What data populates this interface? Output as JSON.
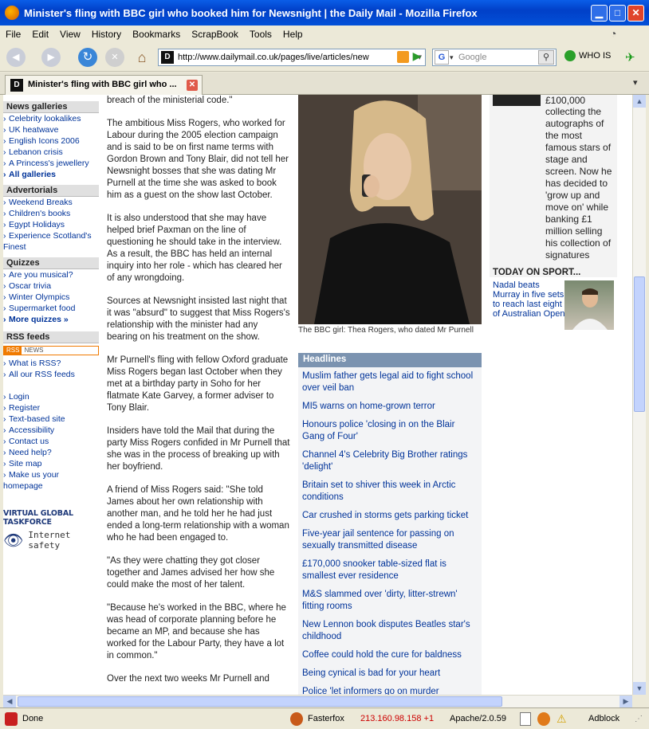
{
  "window": {
    "title": "Minister's fling with BBC girl who booked him for Newsnight | the Daily Mail - Mozilla Firefox"
  },
  "menu": [
    "File",
    "Edit",
    "View",
    "History",
    "Bookmarks",
    "ScrapBook",
    "Tools",
    "Help"
  ],
  "nav": {
    "url": "http://www.dailymail.co.uk/pages/live/articles/new",
    "search_placeholder": "Google",
    "search_engine": "G",
    "whois": "WHO IS"
  },
  "tab": {
    "label": "Minister's fling with BBC girl who ..."
  },
  "sidebar": {
    "news_galleries": {
      "heading": "News galleries",
      "items": [
        "Celebrity lookalikes",
        "UK heatwave",
        "English Icons 2006",
        "Lebanon crisis",
        "A Princess's jewellery",
        "All galleries"
      ]
    },
    "advertorials": {
      "heading": "Advertorials",
      "items": [
        "Weekend Breaks",
        "Children's books",
        "Egypt Holidays",
        "Experience Scotland's",
        "Finest"
      ]
    },
    "quizzes": {
      "heading": "Quizzes",
      "items": [
        "Are you musical?",
        "Oscar trivia",
        "Winter Olympics",
        "Supermarket food",
        "More quizzes »"
      ]
    },
    "rss": {
      "heading": "RSS feeds",
      "badge_rss": "RSS",
      "badge_news": "NEWS",
      "items": [
        "What is RSS?",
        "All our RSS feeds"
      ]
    },
    "util": [
      "Login",
      "Register",
      "Text-based site",
      "Accessibility",
      "Contact us",
      "Need help?",
      "Site map",
      "Make us your",
      "homepage"
    ],
    "vgt": {
      "title": "VIRTUAL GLOBAL TASKFORCE",
      "sub": "Internet safety"
    }
  },
  "article": {
    "paragraphs": [
      "breach of the ministerial code.\"",
      "The ambitious Miss Rogers, who worked for Labour during the 2005 election campaign and is said to be on first name terms with Gordon Brown and Tony Blair, did not tell her Newsnight bosses that she was dating Mr Purnell at the time she was asked to book him as a guest on the show last October.",
      "It is also understood that she may have helped brief Paxman on the line of questioning he should take in the interview. As a result, the BBC has held an internal inquiry into her role - which has cleared her of any wrongdoing.",
      "Sources at Newsnight insisted last night that it was \"absurd\" to suggest that Miss Rogers's relationship with the minister had any bearing on his treatment on the show.",
      "Mr Purnell's fling with fellow Oxford graduate Miss Rogers began last October when they met at a birthday party in Soho for her flatmate Kate Garvey, a former adviser to Tony Blair.",
      "Insiders have told the Mail that during the party Miss Rogers confided in Mr Purnell that she was in the process of breaking up with her boyfriend.",
      "A friend of Miss Rogers said: \"She told James about her own relationship with another man, and he told her he had just ended a long-term relationship with a woman who he had been engaged to.",
      "\"As they were chatting they got closer together and James advised her how she could make the most of her talent.",
      "\"Because he's worked in the BBC, where he was head of corporate planning before he became an MP, and because she has worked for the Labour Party, they have a lot in common.\"",
      "Over the next two weeks Mr Purnell and"
    ]
  },
  "photo": {
    "caption": "The BBC girl: Thea Rogers, who dated Mr Purnell"
  },
  "headlines": {
    "heading": "Headlines",
    "items": [
      "Muslim father gets legal aid to fight school over veil ban",
      "MI5 warns on home-grown terror",
      "Honours police 'closing in on the Blair Gang of Four'",
      "Channel 4's Celebrity Big Brother ratings 'delight'",
      "Britain set to shiver this week in Arctic conditions",
      "Car crushed in storms gets parking ticket",
      "Five-year jail sentence for passing on sexually transmitted disease",
      "£170,000 snooker table-sized flat is smallest ever residence",
      "M&S slammed over 'dirty, litter-strewn' fitting rooms",
      "New Lennon book disputes Beatles star's childhood",
      "Coffee could hold the cure for baldness",
      "Being cynical is bad for your heart",
      "Police 'let informers go on murder"
    ]
  },
  "sidebox": {
    "money": "£100,000",
    "text": "collecting the autographs of the most famous stars of stage and screen. Now he has decided to 'grow up and move on' while banking £1 million selling his collection of signatures",
    "sport_heading": "TODAY ON SPORT...",
    "sport_link": "Nadal beats Murray in five sets to reach last eight of Australian Open"
  },
  "status": {
    "text": "Done",
    "fasterfox": "Fasterfox",
    "ip": "213.160.98.158 +1",
    "server": "Apache/2.0.59",
    "adblock": "Adblock"
  }
}
